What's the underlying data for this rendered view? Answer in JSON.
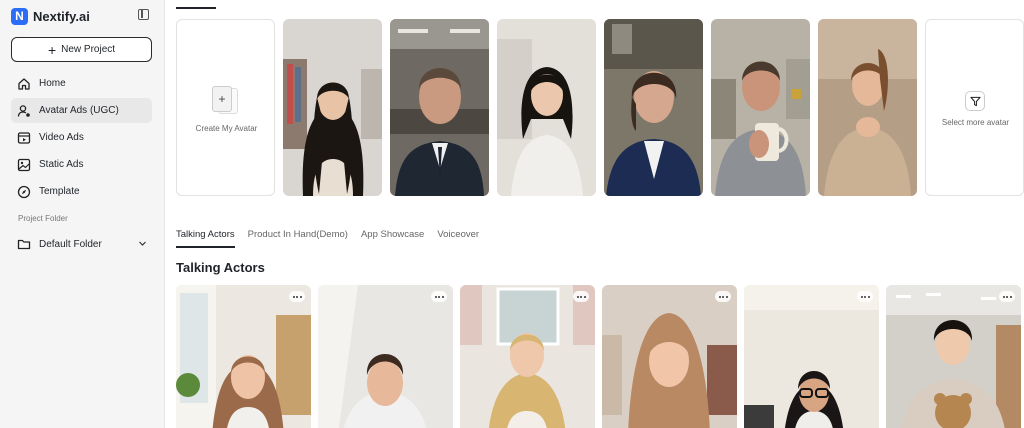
{
  "brand": {
    "logo_letter": "N",
    "name": "Nextify.ai"
  },
  "sidebar": {
    "new_project_label": "New Project",
    "items": [
      {
        "label": "Home",
        "icon": "home-icon"
      },
      {
        "label": "Avatar Ads (UGC)",
        "icon": "user-avatar-icon",
        "active": true
      },
      {
        "label": "Video Ads",
        "icon": "video-icon"
      },
      {
        "label": "Static Ads",
        "icon": "image-icon"
      },
      {
        "label": "Template",
        "icon": "compass-icon"
      }
    ],
    "project_folder_label": "Project Folder",
    "folder": {
      "label": "Default Folder",
      "icon": "folder-icon"
    }
  },
  "avatars": {
    "create_label": "Create My Avatar",
    "more_label": "Select more avatar"
  },
  "tabs": [
    {
      "label": "Talking Actors",
      "active": true
    },
    {
      "label": "Product In Hand(Demo)"
    },
    {
      "label": "App Showcase"
    },
    {
      "label": "Voiceover"
    }
  ],
  "section": {
    "title": "Talking Actors"
  },
  "colors": {
    "accent": "#2d6cf6",
    "sidebar_bg": "#f5f5f5",
    "text": "#1f2329"
  }
}
